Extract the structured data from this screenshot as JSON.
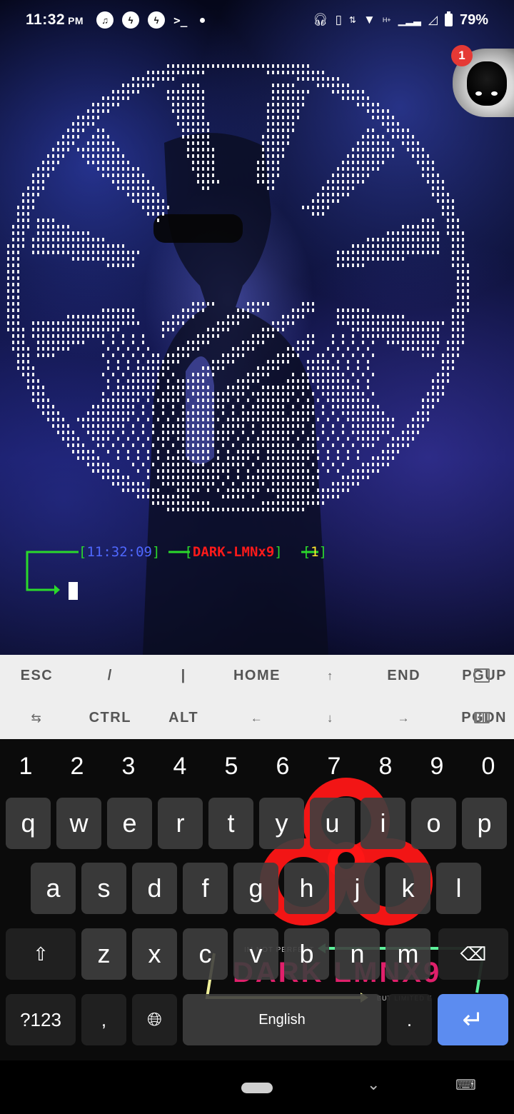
{
  "status_bar": {
    "time": "11:32",
    "ampm": "PM",
    "notification_icons": [
      "music-icon",
      "messenger-icon",
      "messenger-icon",
      "terminal-icon",
      "more-dot-icon"
    ],
    "terminal_glyph": ">_",
    "right_icons": [
      "headphones-icon",
      "vibrate-icon",
      "data-arrows-icon",
      "wifi-icon",
      "signal-icon",
      "battery-icon"
    ],
    "network_type": "H+",
    "battery": "79%"
  },
  "terminal": {
    "prompt": {
      "open1": "[",
      "time": "11:32:09",
      "close1": "]",
      "open2": "[",
      "user": "DARK-LMNx9",
      "close2": "]",
      "open3": "[",
      "count": "1",
      "close3": "]"
    },
    "colors": {
      "bracket": "#2bd92b",
      "time": "#4f68ff",
      "user": "#ff1a1a",
      "count": "#ffe82b"
    }
  },
  "floating_bubble": {
    "badge_count": "1"
  },
  "extra_keys": {
    "row1": [
      "ESC",
      "/",
      "|",
      "HOME",
      "↑",
      "END",
      "PGUP"
    ],
    "row1_last_icon": "copy-icon",
    "row2_first_icon": "tab-icon",
    "row2": [
      "CTRL",
      "ALT",
      "←",
      "↓",
      "→",
      "PGDN"
    ],
    "row2_last_icon": "keyboard-icon"
  },
  "keyboard": {
    "numbers": [
      "1",
      "2",
      "3",
      "4",
      "5",
      "6",
      "7",
      "8",
      "9",
      "0"
    ],
    "row1": [
      "q",
      "w",
      "e",
      "r",
      "t",
      "y",
      "u",
      "i",
      "o",
      "p"
    ],
    "row2": [
      "a",
      "s",
      "d",
      "f",
      "g",
      "h",
      "j",
      "k",
      "l"
    ],
    "row3": [
      "z",
      "x",
      "c",
      "v",
      "b",
      "n",
      "m"
    ],
    "symbols_label": "?123",
    "comma": ",",
    "space_label": "English",
    "period": ".",
    "theme_logo_text": "DARK LMNX9",
    "theme_tagline_top": "IM NOT PERFECT",
    "theme_tagline_bottom": "BUT LIMITED E"
  },
  "nav_bar": {
    "chevron": "⌄",
    "keyboard_glyph": "⌨"
  }
}
